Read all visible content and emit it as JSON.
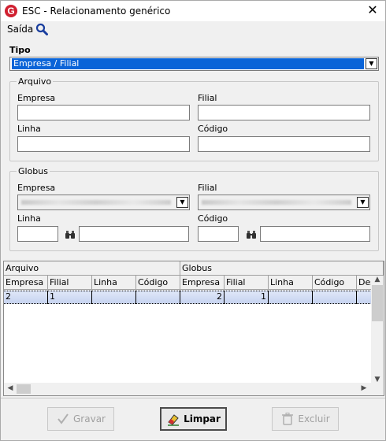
{
  "window": {
    "title": "ESC - Relacionamento genérico",
    "close_label": "✕"
  },
  "menu": {
    "saida": "Saída",
    "search_icon": "search-icon"
  },
  "tipo": {
    "label": "Tipo",
    "value": "Empresa / Filial"
  },
  "arquivo": {
    "legend": "Arquivo",
    "empresa_label": "Empresa",
    "empresa_value": "",
    "filial_label": "Filial",
    "filial_value": "",
    "linha_label": "Linha",
    "linha_value": "",
    "codigo_label": "Código",
    "codigo_value": ""
  },
  "globus": {
    "legend": "Globus",
    "empresa_label": "Empresa",
    "filial_label": "Filial",
    "linha_label": "Linha",
    "linha_value": "",
    "codigo_label": "Código",
    "codigo_value": ""
  },
  "grid": {
    "group_headers": [
      "Arquivo",
      "Globus"
    ],
    "columns": [
      "Empresa",
      "Filial",
      "Linha",
      "Código",
      "Empresa",
      "Filial",
      "Linha",
      "Código",
      "Des"
    ],
    "rows": [
      [
        "2",
        "1",
        "",
        "",
        "2",
        "1",
        "",
        "",
        ""
      ]
    ]
  },
  "buttons": {
    "gravar": "Gravar",
    "limpar": "Limpar",
    "excluir": "Excluir"
  },
  "colors": {
    "selection": "#0a64d8",
    "logo": "#d02030"
  }
}
